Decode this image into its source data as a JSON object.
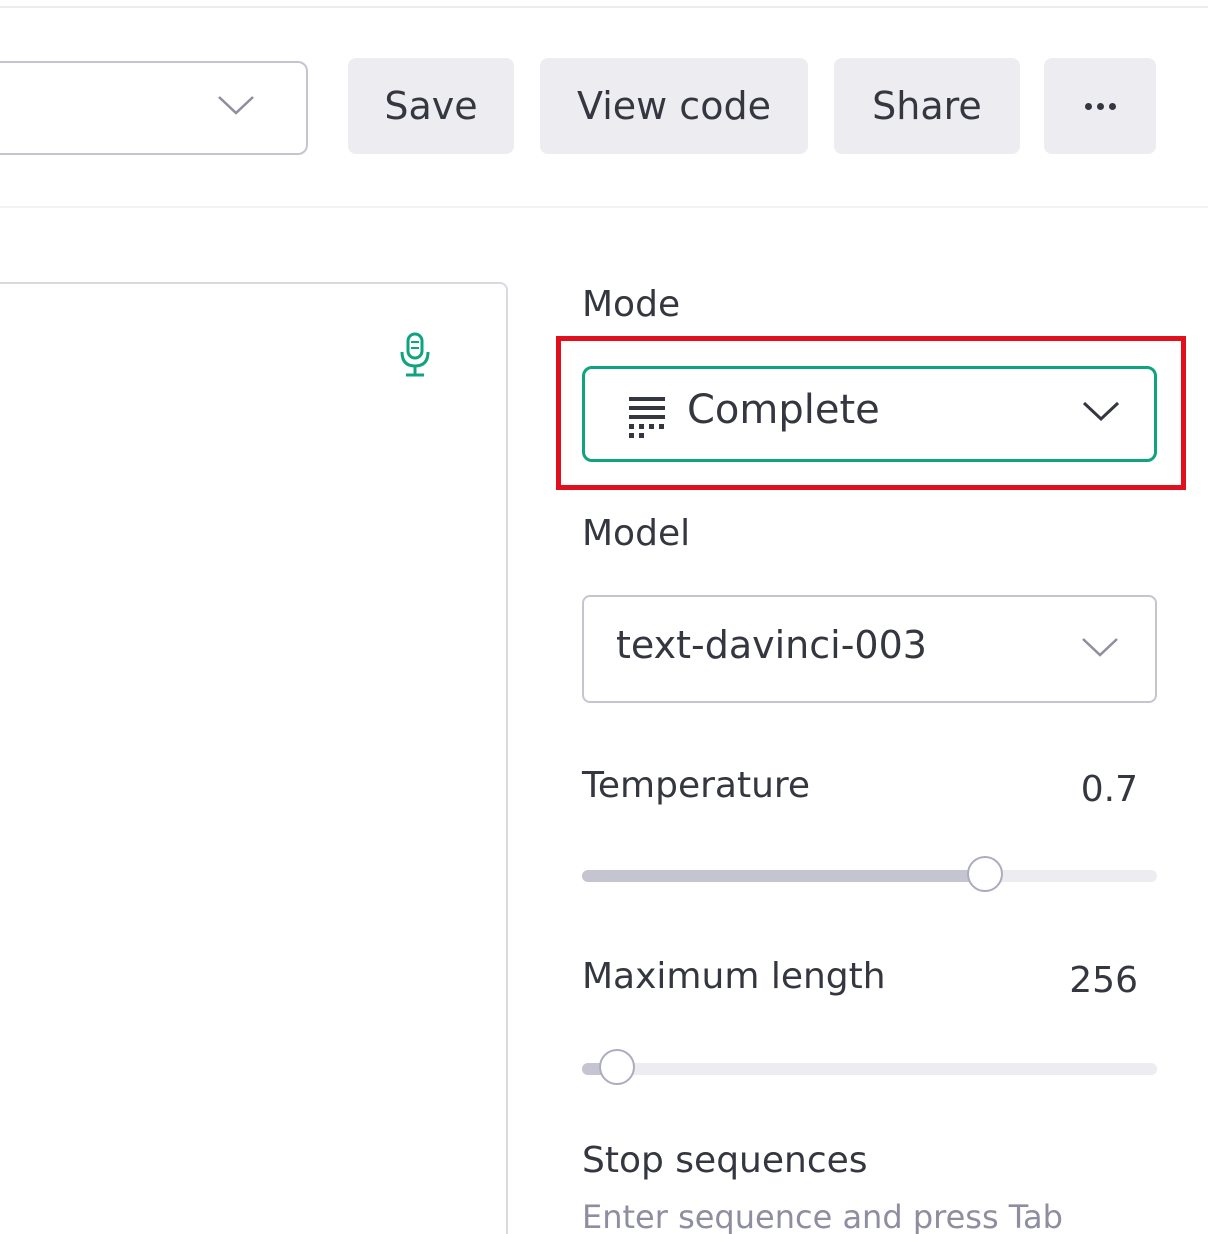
{
  "toolbar": {
    "save_label": "Save",
    "view_code_label": "View code",
    "share_label": "Share",
    "more_icon": "ellipsis-icon"
  },
  "settings": {
    "mode": {
      "label": "Mode",
      "value": "Complete",
      "icon": "complete-mode-icon",
      "highlight_color": "#e0101c"
    },
    "model": {
      "label": "Model",
      "value": "text-davinci-003"
    },
    "temperature": {
      "label": "Temperature",
      "value": "0.7",
      "fraction": 0.7
    },
    "maximum_length": {
      "label": "Maximum length",
      "value": "256",
      "fraction": 0.06
    },
    "stop_sequences": {
      "label": "Stop sequences",
      "placeholder": "Enter sequence and press Tab"
    }
  },
  "colors": {
    "accent": "#10a37f",
    "highlight": "#e0101c"
  }
}
